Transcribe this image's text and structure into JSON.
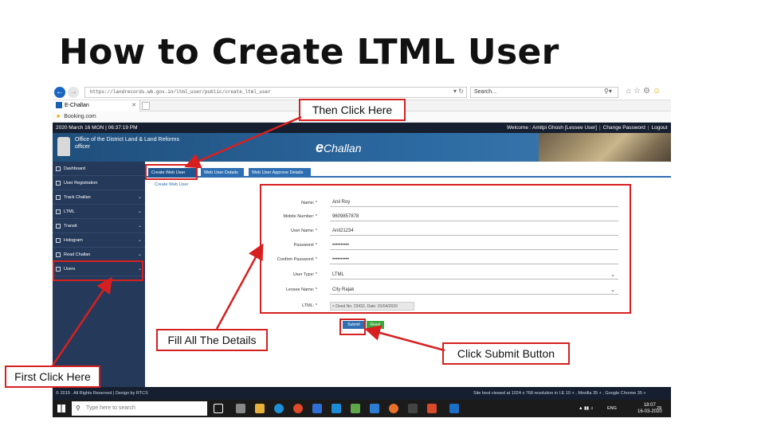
{
  "slide": {
    "title": "How to Create LTML User"
  },
  "browser": {
    "url": "https://landrecords.wb.gov.in/ltml_user/public/create_ltml_user",
    "search_placeholder": "Search...",
    "tab_title": "E-Challan",
    "favorite": "Booking.com"
  },
  "site": {
    "datetime": "2020 March 16 MON | 06:37:19 PM",
    "welcome": "Welcome : Amitpi Ghosh [Lessee User]",
    "change_password": "Change Password",
    "logout": "Logout",
    "office": "Office of the District Land & Land Reforms officer",
    "brand_e": "e",
    "brand_rest": "Challan"
  },
  "sidebar": {
    "items": [
      {
        "label": "Dashboard"
      },
      {
        "label": "User Registration"
      },
      {
        "label": "Track Challan"
      },
      {
        "label": "LTML"
      },
      {
        "label": "Transit"
      },
      {
        "label": "Hologram"
      },
      {
        "label": "Read Challan"
      },
      {
        "label": "Users"
      }
    ]
  },
  "content": {
    "tabs": [
      {
        "label": "Create Web User"
      },
      {
        "label": "Web User Details"
      },
      {
        "label": "Web User Approve Details"
      }
    ],
    "form_caption": "Create Web User"
  },
  "form": {
    "fields": [
      {
        "label": "Name: *",
        "value": "Anil Roy"
      },
      {
        "label": "Mobile Number: *",
        "value": "9609857878"
      },
      {
        "label": "User Name: *",
        "value": "Anil21234"
      },
      {
        "label": "Password: *",
        "value": "••••••••••"
      },
      {
        "label": "Confirm Password: *",
        "value": "••••••••••"
      },
      {
        "label": "User Type: *",
        "value": "LTML"
      },
      {
        "label": "Lessee Name: *",
        "value": "City Rajak"
      },
      {
        "label": "LTML: *",
        "value": "× Deed No: 23432, Date: 01/04/2020"
      }
    ],
    "submit_label": "Submit",
    "reset_label": "Reset"
  },
  "footer": {
    "left": "© 2019 . All Rights Reserved | Design by RTCS",
    "right": "Site best viewed at 1024 x 768 resolution in I.E 10 + , Mozilla 35 + , Google Chrome 35 +"
  },
  "taskbar": {
    "search_placeholder": "Type here to search",
    "lang": "ENG",
    "time": "18:07",
    "date": "16-03-2020",
    "notif": "29"
  },
  "annotations": {
    "then_click": "Then Click Here",
    "fill_details": "Fill All The Details",
    "click_submit": "Click Submit Button",
    "first_click": "First Click Here"
  },
  "colors": {
    "annotation": "#d62020",
    "sidebar": "#25395a",
    "accent": "#2e6fb3"
  }
}
